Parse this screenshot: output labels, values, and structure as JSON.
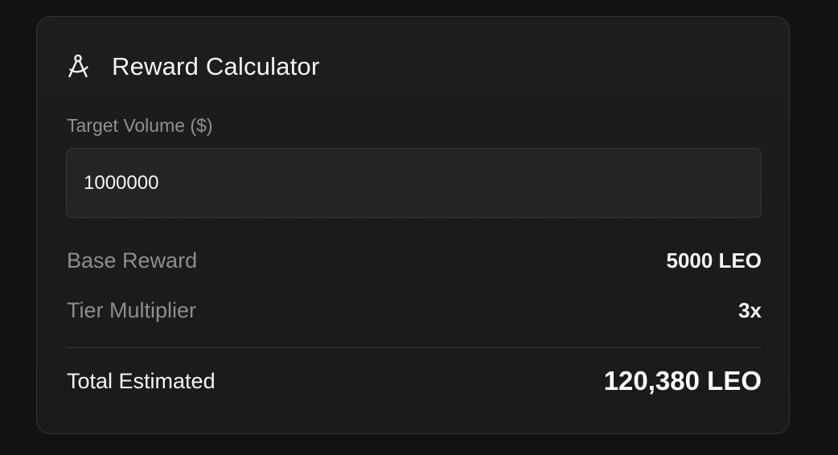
{
  "calculator": {
    "title": "Reward Calculator",
    "icon": "compass-icon",
    "target_volume": {
      "label": "Target Volume ($)",
      "value": "1000000"
    },
    "base_reward": {
      "label": "Base Reward",
      "value": "5000 LEO"
    },
    "tier_multiplier": {
      "label": "Tier Multiplier",
      "value": "3x"
    },
    "total_estimated": {
      "label": "Total Estimated",
      "value": "120,380 LEO"
    }
  },
  "colors": {
    "background": "#111312",
    "card": "#1b1d1d",
    "muted_text": "#8a8e8e",
    "primary_text": "#f3f4f4"
  }
}
